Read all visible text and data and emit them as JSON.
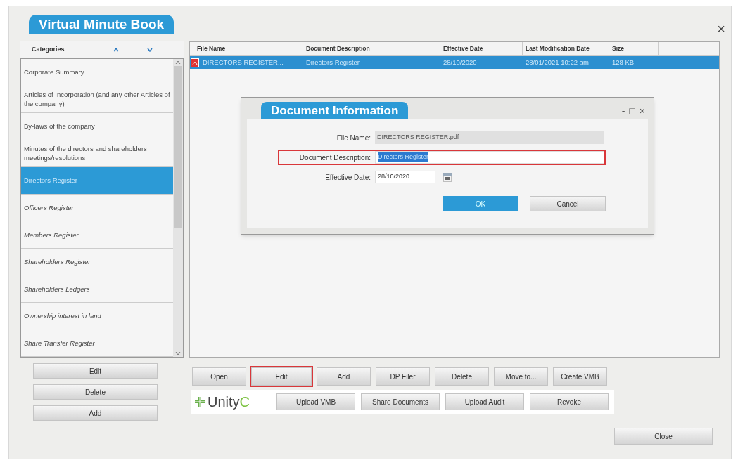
{
  "window": {
    "title": "Virtual Minute Book",
    "close": "×"
  },
  "categories": {
    "header": "Categories",
    "items": [
      {
        "label": "Corporate Summary",
        "selected": false
      },
      {
        "label": "Articles of Incorporation (and any other Articles of the company)",
        "selected": false
      },
      {
        "label": "By-laws of the company",
        "selected": false
      },
      {
        "label": "Minutes of the directors and shareholders meetings/resolutions",
        "selected": false
      },
      {
        "label": "Directors Register",
        "selected": true
      },
      {
        "label": "Officers Register",
        "selected": false
      },
      {
        "label": "Members Register",
        "selected": false
      },
      {
        "label": "Shareholders Register",
        "selected": false
      },
      {
        "label": "Shareholders Ledgers",
        "selected": false
      },
      {
        "label": "Ownership interest in land",
        "selected": false
      },
      {
        "label": "Share Transfer Register",
        "selected": false
      }
    ],
    "buttons": [
      "Edit",
      "Delete",
      "Add"
    ]
  },
  "table": {
    "columns": [
      "File Name",
      "Document Description",
      "Effective Date",
      "Last Modification Date",
      "Size"
    ],
    "rows": [
      {
        "selected": true,
        "cells": [
          "DIRECTORS REGISTER...",
          "Directors Register",
          "28/10/2020",
          "28/01/2021 10:22 am",
          "128 KB"
        ]
      }
    ]
  },
  "dialog": {
    "title": "Document Information",
    "controls": [
      "-",
      "□",
      "×"
    ],
    "fields": [
      {
        "label": "File Name:",
        "value": "DIRECTORS REGISTER.pdf",
        "disabled": true,
        "highlighted": false,
        "text_selected": false
      },
      {
        "label": "Document Description:",
        "value": "Directors Register",
        "disabled": false,
        "highlighted": true,
        "text_selected": true
      },
      {
        "label": "Effective Date:",
        "value": "28/10/2020",
        "disabled": false,
        "highlighted": false,
        "text_selected": false,
        "kind": "date"
      }
    ],
    "buttons": [
      {
        "label": "OK",
        "primary": true
      },
      {
        "label": "Cancel",
        "primary": false
      }
    ]
  },
  "toolbar": [
    {
      "label": "Open",
      "highlighted": false
    },
    {
      "label": "Edit",
      "highlighted": true
    },
    {
      "label": "Add",
      "highlighted": false
    },
    {
      "label": "DP Filer",
      "highlighted": false
    },
    {
      "label": "Delete",
      "highlighted": false
    },
    {
      "label": "Move to...",
      "highlighted": false
    },
    {
      "label": "Create VMB",
      "highlighted": false
    }
  ],
  "unity": {
    "logo": "Unity",
    "logo_accent": "C",
    "buttons": [
      "Upload VMB",
      "Share Documents",
      "Upload Audit",
      "Revoke"
    ]
  },
  "close_button": "Close"
}
